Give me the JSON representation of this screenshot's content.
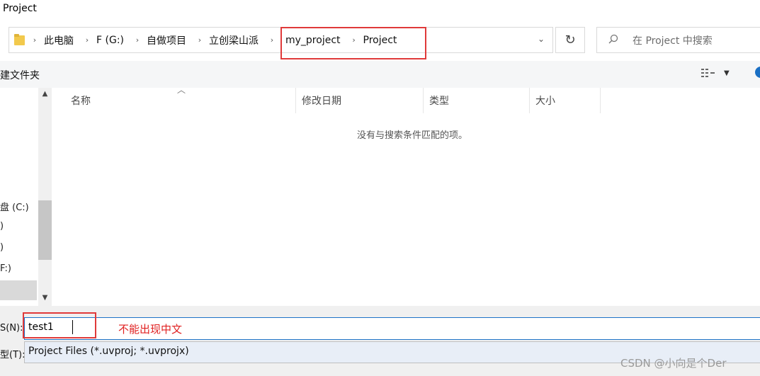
{
  "window": {
    "title": "Project"
  },
  "address_bar": {
    "crumbs": [
      "此电脑",
      "F (G:)",
      "自做项目",
      "立创梁山派",
      "my_project",
      "Project"
    ],
    "separator_icon": "chevron-right-icon",
    "dropdown_icon": "chevron-down-icon"
  },
  "refresh": {
    "icon": "refresh-icon",
    "glyph": "↻"
  },
  "search": {
    "placeholder": "在 Project 中搜索",
    "icon": "search-icon"
  },
  "toolbar": {
    "new_folder_label": "建文件夹",
    "view_icon": "view-options-icon",
    "help_icon": "help-icon"
  },
  "nav": {
    "items": [
      "盘 (C:)",
      ")",
      ")",
      "F:)"
    ]
  },
  "list": {
    "columns": [
      "名称",
      "修改日期",
      "类型",
      "大小"
    ],
    "empty_message": "没有与搜索条件匹配的项。"
  },
  "form": {
    "filename_label": "S(N):",
    "filename_value": "test1",
    "filetype_label": "型(T):",
    "filetype_value": "Project Files (*.uvproj; *.uvprojx)"
  },
  "annotations": {
    "note": "不能出现中文",
    "highlight_color": "#e03a3a"
  },
  "watermark": "CSDN @小向是个Der"
}
